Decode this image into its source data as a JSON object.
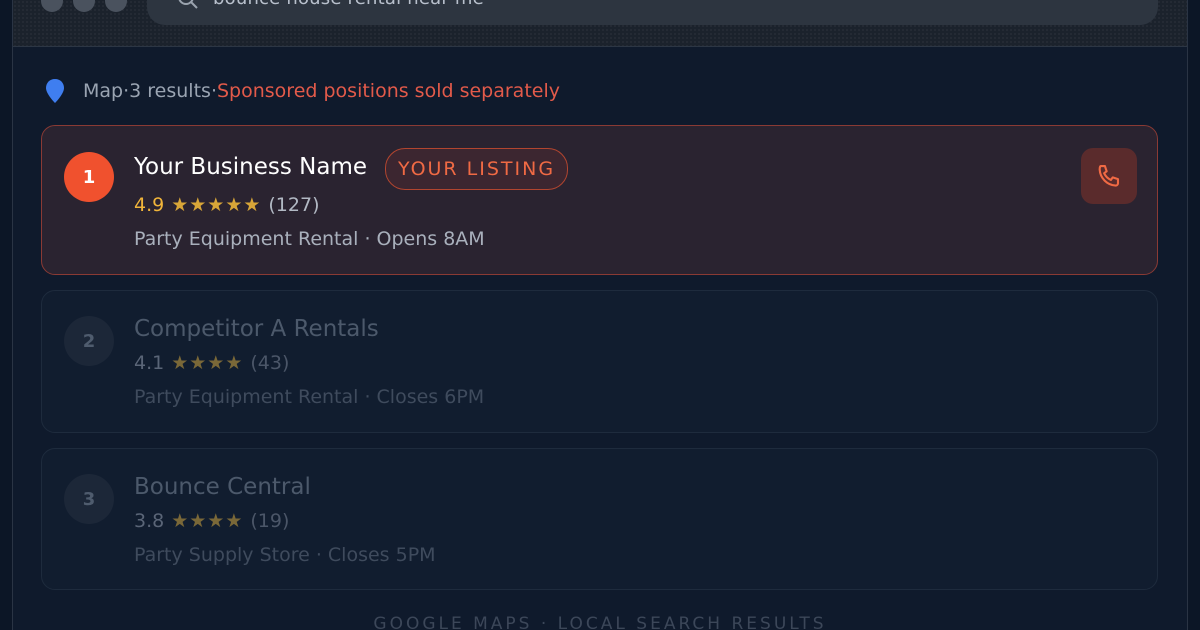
{
  "search": {
    "query": "bounce house rental near me"
  },
  "results_header": {
    "map_label": "Map",
    "sep1": " · ",
    "count": "3 results",
    "sep2": " · ",
    "sponsored_note": "Sponsored positions sold separately"
  },
  "listings": [
    {
      "rank": "1",
      "name": "Your Business Name",
      "badge": "YOUR LISTING",
      "rating": "4.9",
      "stars": "★★★★★",
      "reviews": "(127)",
      "description": "Party Equipment Rental · Opens 8AM",
      "call_icon": "phone-icon"
    },
    {
      "rank": "2",
      "name": "Competitor A Rentals",
      "rating": "4.1",
      "stars": "★★★★",
      "reviews": "(43)",
      "description": "Party Equipment Rental · Closes 6PM"
    },
    {
      "rank": "3",
      "name": "Bounce Central",
      "rating": "3.8",
      "stars": "★★★★",
      "reviews": "(19)",
      "description": "Party Supply Store · Closes 5PM"
    }
  ],
  "footer": {
    "label": "GOOGLE MAPS · LOCAL SEARCH RESULTS"
  },
  "colors": {
    "accent": "#f0512e",
    "star": "#d8a638",
    "sponsored": "#e25a4a",
    "background": "#0c1626"
  }
}
